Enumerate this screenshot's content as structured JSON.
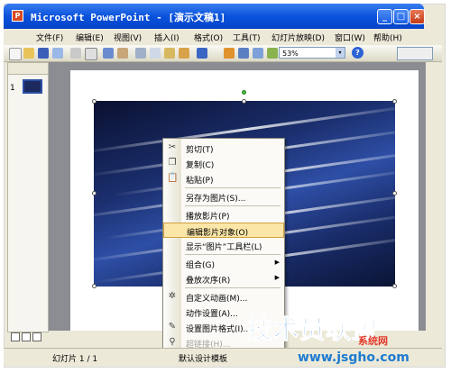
{
  "window": {
    "title": "Microsoft PowerPoint - [演示文稿1]",
    "icon_glyph": "P",
    "min_glyph": "_",
    "max_glyph": "□",
    "close_glyph": "×"
  },
  "menubar": {
    "items": [
      "文件(F)",
      "编辑(E)",
      "视图(V)",
      "插入(I)",
      "格式(O)",
      "工具(T)",
      "幻灯片放映(D)",
      "窗口(W)",
      "帮助(H)"
    ]
  },
  "toolbar": {
    "zoom": "53%",
    "help_glyph": "?",
    "arrow_glyph": "▾"
  },
  "slide_panel": {
    "slide_number": "1"
  },
  "context_menu": {
    "items": [
      {
        "label": "剪切(T)",
        "icon": "scissors-icon",
        "glyph": "✂"
      },
      {
        "label": "复制(C)",
        "icon": "copy-icon",
        "glyph": "❐"
      },
      {
        "label": "粘贴(P)",
        "icon": "paste-icon",
        "glyph": "📋"
      },
      {
        "label": "另存为图片(S)...",
        "icon": "",
        "glyph": ""
      },
      {
        "label": "播放影片(P)",
        "icon": "",
        "glyph": ""
      },
      {
        "label": "编辑影片对象(O)",
        "icon": "",
        "glyph": ""
      },
      {
        "label": "显示“图片”工具栏(L)",
        "icon": "",
        "glyph": ""
      },
      {
        "label": "组合(G)",
        "icon": "",
        "glyph": "",
        "submenu": "▶"
      },
      {
        "label": "叠放次序(R)",
        "icon": "",
        "glyph": "",
        "submenu": "▶"
      },
      {
        "label": "自定义动画(M)...",
        "icon": "custom-animation-icon",
        "glyph": "✲"
      },
      {
        "label": "动作设置(A)...",
        "icon": "",
        "glyph": ""
      },
      {
        "label": "设置图片格式(I)...",
        "icon": "format-picture-icon",
        "glyph": "✎"
      },
      {
        "label": "超链接(H)...",
        "icon": "hyperlink-icon",
        "glyph": "⚲"
      }
    ]
  },
  "statusbar": {
    "slide": "幻灯片 1 / 1",
    "design": "默认设计模板"
  },
  "watermark": {
    "cn": "技术员联盟",
    "url": "www.jsgho.com",
    "red": "系统网"
  }
}
